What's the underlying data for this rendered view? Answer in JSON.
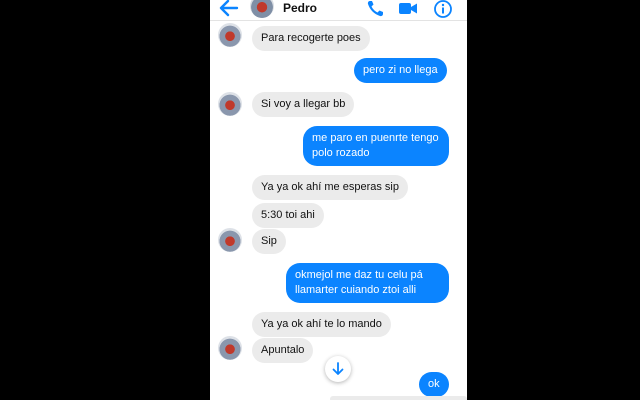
{
  "header": {
    "contact_name": "Pedro",
    "icons": [
      "back-arrow-icon",
      "phone-icon",
      "video-camera-icon",
      "info-icon"
    ],
    "accent_color": "#0b84ff"
  },
  "messages": [
    {
      "side": "in",
      "text": "Para recogerte poes"
    },
    {
      "side": "out",
      "text": "pero zi no llega"
    },
    {
      "side": "in",
      "text": "Si voy a llegar bb"
    },
    {
      "side": "out",
      "lines": [
        "me paro en puenrte tengo",
        "polo rozado"
      ]
    },
    {
      "side": "in",
      "text": "Ya ya ok ahí me esperas sip"
    },
    {
      "side": "in",
      "text": "5:30 toi ahi"
    },
    {
      "side": "in",
      "text": "Sip"
    },
    {
      "side": "out",
      "lines": [
        "okmejol me daz tu celu pá",
        "llamarter cuiando ztoi alli"
      ]
    },
    {
      "side": "in",
      "text": "Ya ya ok ahí te lo mando"
    },
    {
      "side": "in",
      "text": "Apuntalo"
    },
    {
      "side": "out",
      "text": "ok"
    }
  ]
}
